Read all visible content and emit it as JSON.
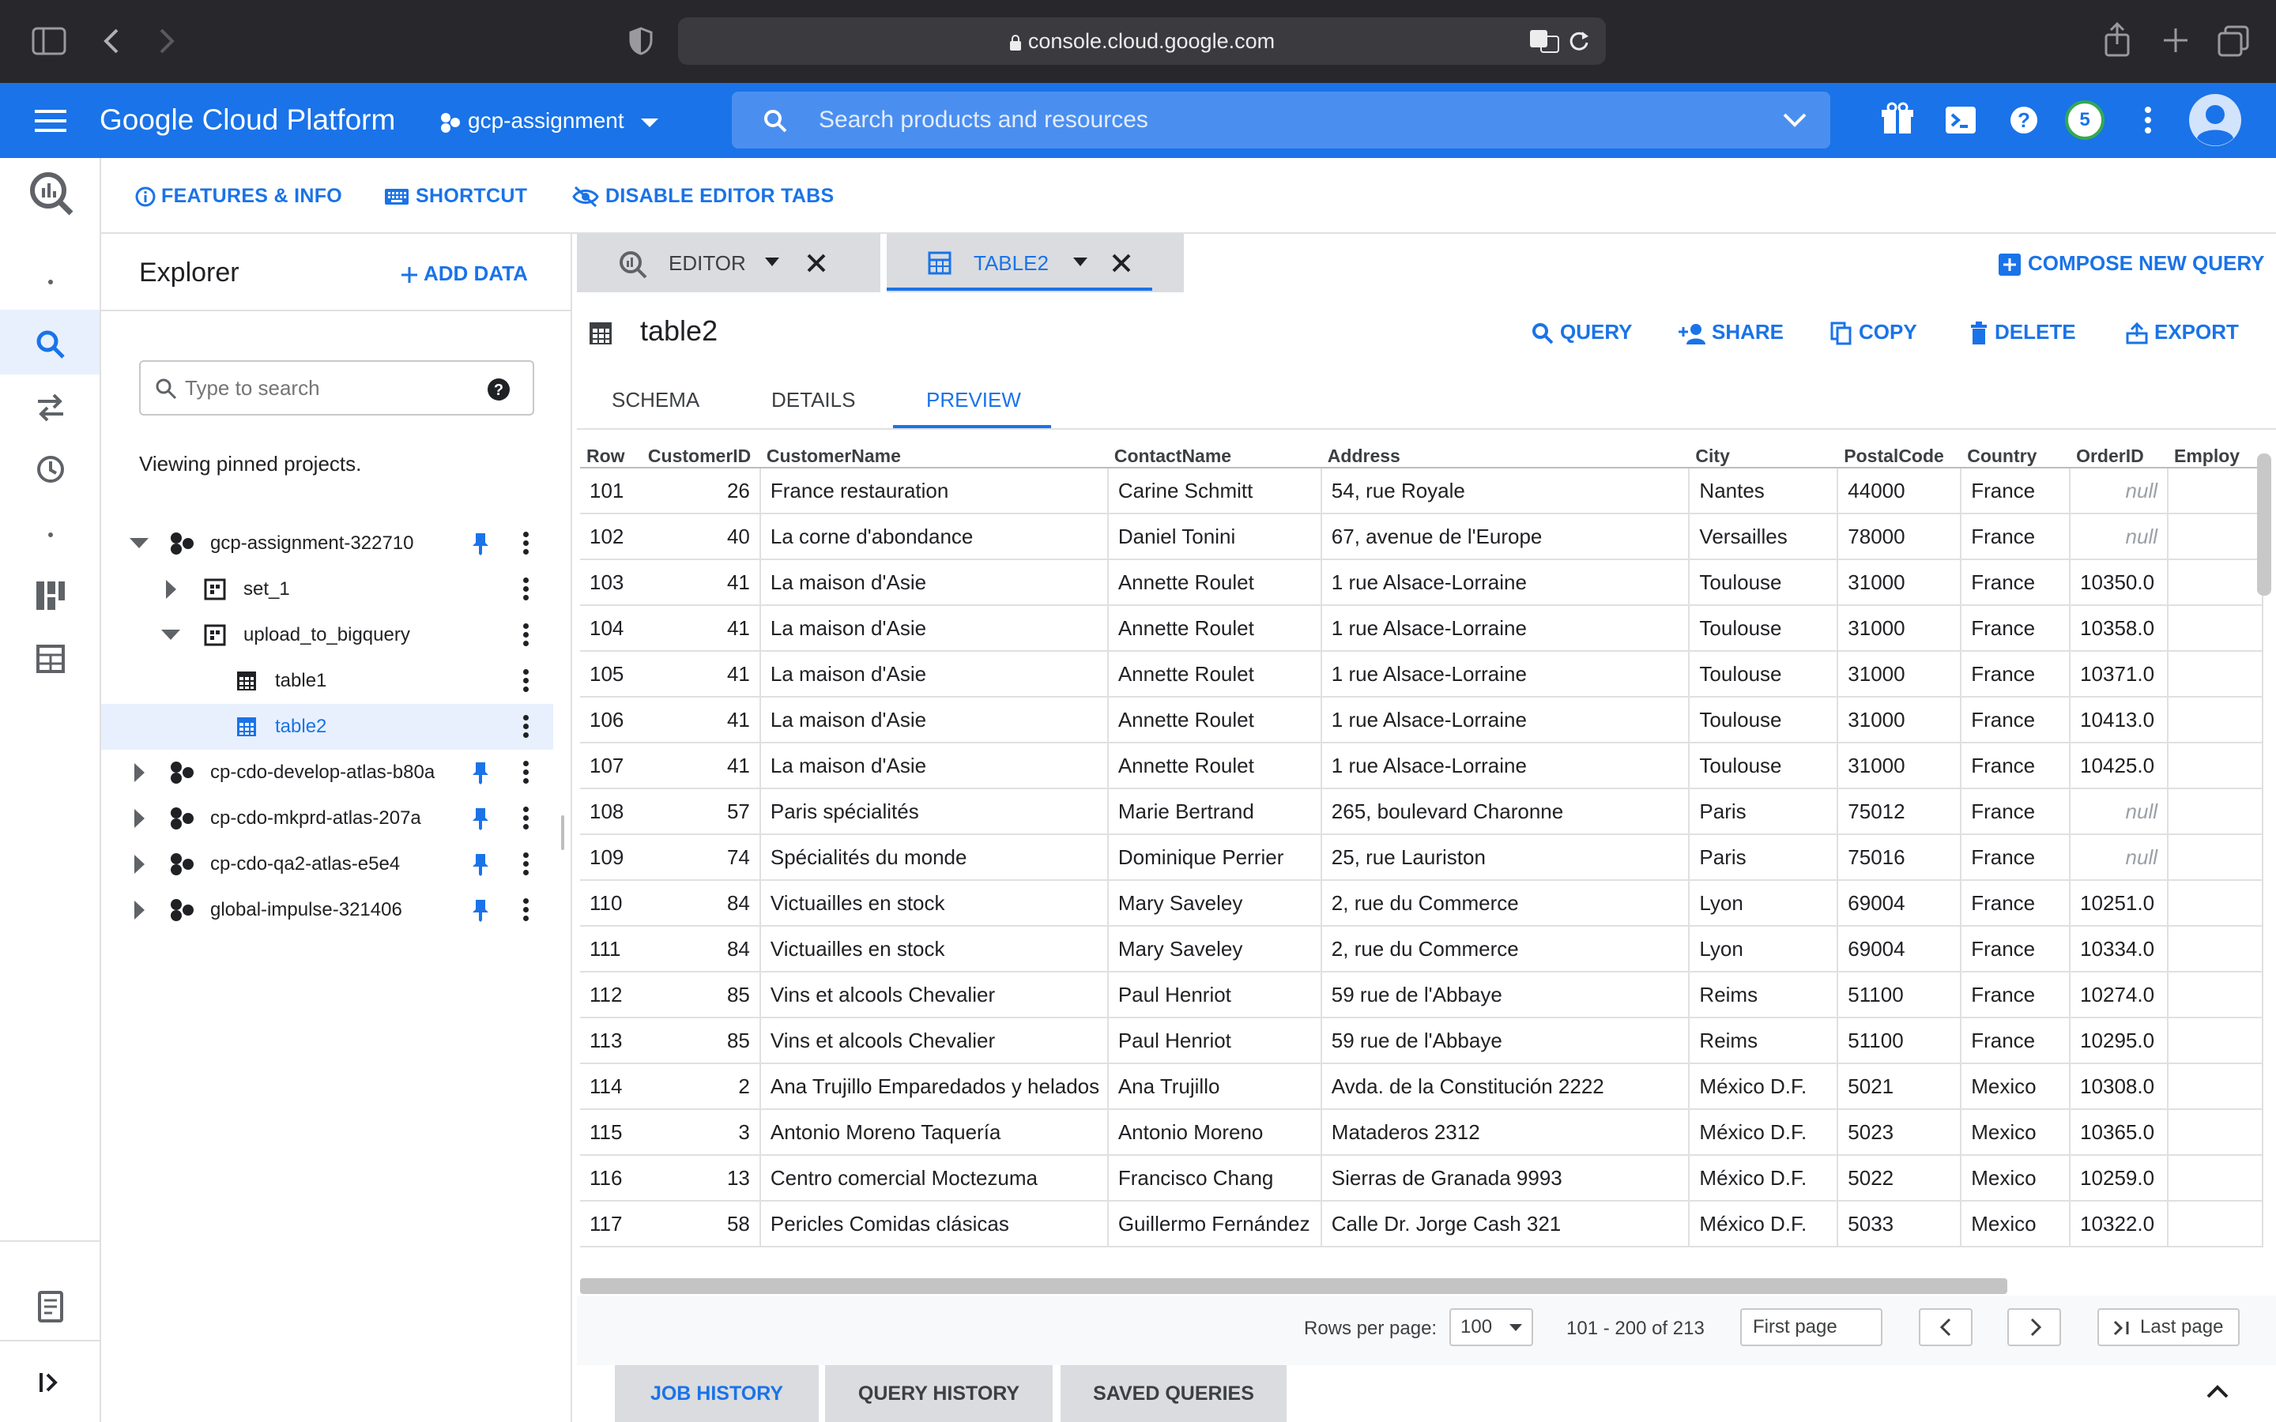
{
  "browser": {
    "url": "console.cloud.google.com"
  },
  "header": {
    "product": "Google Cloud Platform",
    "project": "gcp-assignment",
    "search_placeholder": "Search products and resources",
    "notification_count": "5"
  },
  "toolbar": {
    "features": "FEATURES & INFO",
    "shortcut": "SHORTCUT",
    "disable_tabs": "DISABLE EDITOR TABS",
    "compose": "COMPOSE NEW QUERY"
  },
  "explorer": {
    "title": "Explorer",
    "add_data": "ADD DATA",
    "search_placeholder": "Type to search",
    "viewing": "Viewing pinned projects.",
    "nodes": [
      {
        "label": "gcp-assignment-322710"
      },
      {
        "label": "set_1"
      },
      {
        "label": "upload_to_bigquery"
      },
      {
        "label": "table1"
      },
      {
        "label": "table2"
      },
      {
        "label": "cp-cdo-develop-atlas-b80a"
      },
      {
        "label": "cp-cdo-mkprd-atlas-207a"
      },
      {
        "label": "cp-cdo-qa2-atlas-e5e4"
      },
      {
        "label": "global-impulse-321406"
      }
    ]
  },
  "editor_tabs": [
    {
      "label": "EDITOR"
    },
    {
      "label": "TABLE2"
    }
  ],
  "table_view": {
    "name": "table2",
    "actions": {
      "query": "QUERY",
      "share": "SHARE",
      "copy": "COPY",
      "delete": "DELETE",
      "export": "EXPORT"
    },
    "tabs": [
      {
        "label": "SCHEMA"
      },
      {
        "label": "DETAILS"
      },
      {
        "label": "PREVIEW"
      }
    ],
    "columns": [
      "Row",
      "CustomerID",
      "CustomerName",
      "ContactName",
      "Address",
      "City",
      "PostalCode",
      "Country",
      "OrderID",
      "Employ"
    ],
    "rows": [
      [
        "101",
        "26",
        "France restauration",
        "Carine Schmitt",
        "54, rue Royale",
        "Nantes",
        "44000",
        "France",
        "null",
        ""
      ],
      [
        "102",
        "40",
        "La corne d'abondance",
        "Daniel Tonini",
        "67, avenue de l'Europe",
        "Versailles",
        "78000",
        "France",
        "null",
        ""
      ],
      [
        "103",
        "41",
        "La maison d'Asie",
        "Annette Roulet",
        "1 rue Alsace-Lorraine",
        "Toulouse",
        "31000",
        "France",
        "10350.0",
        ""
      ],
      [
        "104",
        "41",
        "La maison d'Asie",
        "Annette Roulet",
        "1 rue Alsace-Lorraine",
        "Toulouse",
        "31000",
        "France",
        "10358.0",
        ""
      ],
      [
        "105",
        "41",
        "La maison d'Asie",
        "Annette Roulet",
        "1 rue Alsace-Lorraine",
        "Toulouse",
        "31000",
        "France",
        "10371.0",
        ""
      ],
      [
        "106",
        "41",
        "La maison d'Asie",
        "Annette Roulet",
        "1 rue Alsace-Lorraine",
        "Toulouse",
        "31000",
        "France",
        "10413.0",
        ""
      ],
      [
        "107",
        "41",
        "La maison d'Asie",
        "Annette Roulet",
        "1 rue Alsace-Lorraine",
        "Toulouse",
        "31000",
        "France",
        "10425.0",
        ""
      ],
      [
        "108",
        "57",
        "Paris spécialités",
        "Marie Bertrand",
        "265, boulevard Charonne",
        "Paris",
        "75012",
        "France",
        "null",
        ""
      ],
      [
        "109",
        "74",
        "Spécialités du monde",
        "Dominique Perrier",
        "25, rue Lauriston",
        "Paris",
        "75016",
        "France",
        "null",
        ""
      ],
      [
        "110",
        "84",
        "Victuailles en stock",
        "Mary Saveley",
        "2, rue du Commerce",
        "Lyon",
        "69004",
        "France",
        "10251.0",
        ""
      ],
      [
        "111",
        "84",
        "Victuailles en stock",
        "Mary Saveley",
        "2, rue du Commerce",
        "Lyon",
        "69004",
        "France",
        "10334.0",
        ""
      ],
      [
        "112",
        "85",
        "Vins et alcools Chevalier",
        "Paul Henriot",
        "59 rue de l'Abbaye",
        "Reims",
        "51100",
        "France",
        "10274.0",
        ""
      ],
      [
        "113",
        "85",
        "Vins et alcools Chevalier",
        "Paul Henriot",
        "59 rue de l'Abbaye",
        "Reims",
        "51100",
        "France",
        "10295.0",
        ""
      ],
      [
        "114",
        "2",
        "Ana Trujillo Emparedados y helados",
        "Ana Trujillo",
        "Avda. de la Constitución 2222",
        "México D.F.",
        "5021",
        "Mexico",
        "10308.0",
        ""
      ],
      [
        "115",
        "3",
        "Antonio Moreno Taquería",
        "Antonio Moreno",
        "Mataderos 2312",
        "México D.F.",
        "5023",
        "Mexico",
        "10365.0",
        ""
      ],
      [
        "116",
        "13",
        "Centro comercial Moctezuma",
        "Francisco Chang",
        "Sierras de Granada 9993",
        "México D.F.",
        "5022",
        "Mexico",
        "10259.0",
        ""
      ],
      [
        "117",
        "58",
        "Pericles Comidas clásicas",
        "Guillermo Fernández",
        "Calle Dr. Jorge Cash 321",
        "México D.F.",
        "5033",
        "Mexico",
        "10322.0",
        ""
      ]
    ]
  },
  "pager": {
    "rows_per_page_label": "Rows per page:",
    "rows_per_page": "100",
    "range": "101 - 200 of 213",
    "first": "First page",
    "last": "Last page"
  },
  "bottom_tabs": [
    {
      "label": "JOB HISTORY"
    },
    {
      "label": "QUERY HISTORY"
    },
    {
      "label": "SAVED QUERIES"
    }
  ],
  "colors": {
    "brand": "#1a73e8",
    "browser": "#28272b",
    "selection": "#e8f0fe"
  }
}
